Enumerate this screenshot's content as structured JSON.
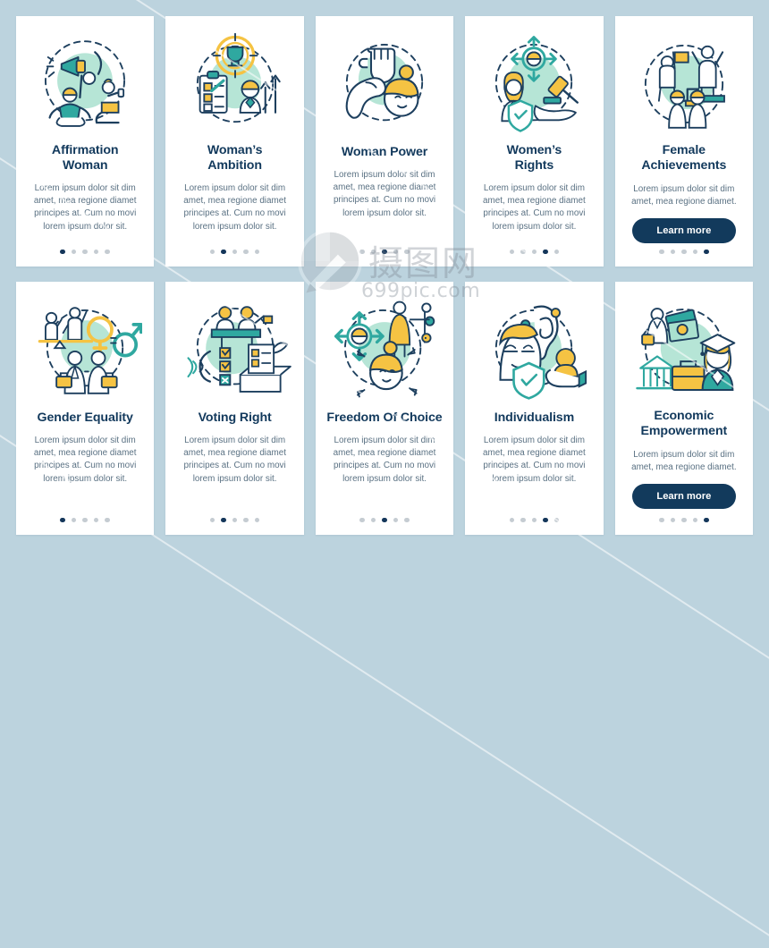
{
  "page": {
    "background_color": "#bcd3de",
    "card_background": "#ffffff",
    "title_color": "#12395c",
    "body_color": "#5a7183",
    "accent_teal": "#2fa8a0",
    "accent_mint": "#a8e0cd",
    "accent_yellow": "#f5c343",
    "button_color": "#123a5c",
    "dot_active_color": "#14365a",
    "dot_inactive_color": "#c5ccd2"
  },
  "watermark": {
    "chinese": "摄图网",
    "url": "699pic.com"
  },
  "common": {
    "lorem_long": "Lorem ipsum dolor sit dim amet, mea regione diamet principes at. Cum no movi lorem ipsum dolor sit.",
    "lorem_short": "Lorem ipsum dolor sit dim amet, mea regione diamet.",
    "learn_more_label": "Learn more"
  },
  "rows": [
    {
      "id": "row-1",
      "cards": [
        {
          "id": "affirmation-woman",
          "title": "Affirmation\nWoman",
          "title_line1": "Affirmation",
          "title_line2": "Woman",
          "description": "Lorem ipsum dolor sit dim amet, mea regione diamet principes at. Cum no movi lorem ipsum dolor sit.",
          "has_button": false,
          "button_label": "",
          "dots_total": 5,
          "dot_active_index": 0,
          "illustration": "megaphone-woman-dumbbell-icon"
        },
        {
          "id": "womans-ambition",
          "title": "Woman’s\nAmbition",
          "title_line1": "Woman’s",
          "title_line2": "Ambition",
          "description": "Lorem ipsum dolor sit dim amet, mea regione diamet principes at. Cum no movi lorem ipsum dolor sit.",
          "has_button": false,
          "button_label": "",
          "dots_total": 5,
          "dot_active_index": 1,
          "illustration": "trophy-target-checklist-icon"
        },
        {
          "id": "woman-power",
          "title": "Woman Power",
          "title_line1": "Woman Power",
          "title_line2": "",
          "description": "Lorem ipsum dolor sit dim amet, mea regione diamet principes at. Cum no movi lorem ipsum dolor sit.",
          "has_button": false,
          "button_label": "",
          "dots_total": 5,
          "dot_active_index": 2,
          "illustration": "fist-muscle-woman-icon"
        },
        {
          "id": "womens-rights",
          "title": "Women’s\nRights",
          "title_line1": "Women’s",
          "title_line2": "Rights",
          "description": "Lorem ipsum dolor sit dim amet, mea regione diamet principes at. Cum no movi lorem ipsum dolor sit.",
          "has_button": false,
          "button_label": "",
          "dots_total": 5,
          "dot_active_index": 3,
          "illustration": "gavel-shield-arrows-icon"
        },
        {
          "id": "female-achievements",
          "title": "Female\nAchievements",
          "title_line1": "Female",
          "title_line2": "Achievements",
          "description": "Lorem ipsum dolor sit dim amet, mea regione diamet.",
          "has_button": true,
          "button_label": "Learn more",
          "dots_total": 5,
          "dot_active_index": 4,
          "illustration": "podium-flag-stairs-icon"
        }
      ]
    },
    {
      "id": "row-2",
      "cards": [
        {
          "id": "gender-equality",
          "title": "Gender Equality",
          "title_line1": "Gender Equality",
          "title_line2": "",
          "description": "Lorem ipsum dolor sit dim amet, mea regione diamet principes at. Cum no movi lorem ipsum dolor sit.",
          "has_button": false,
          "button_label": "",
          "dots_total": 5,
          "dot_active_index": 0,
          "illustration": "scales-gender-symbols-icon"
        },
        {
          "id": "voting-right",
          "title": "Voting Right",
          "title_line1": "Voting Right",
          "title_line2": "",
          "description": "Lorem ipsum dolor sit dim amet, mea regione diamet principes at. Cum no movi lorem ipsum dolor sit.",
          "has_button": false,
          "button_label": "",
          "dots_total": 5,
          "dot_active_index": 1,
          "illustration": "ballot-box-checklist-icon"
        },
        {
          "id": "freedom-of-choice",
          "title": "Freedom Of Choice",
          "title_line1": "Freedom Of Choice",
          "title_line2": "",
          "description": "Lorem ipsum dolor sit dim amet, mea regione diamet principes at. Cum no movi lorem ipsum dolor sit.",
          "has_button": false,
          "button_label": "",
          "dots_total": 5,
          "dot_active_index": 2,
          "illustration": "arrows-choice-woman-icon"
        },
        {
          "id": "individualism",
          "title": "Individualism",
          "title_line1": "Individualism",
          "title_line2": "",
          "description": "Lorem ipsum dolor sit dim amet, mea regione diamet principes at. Cum no movi lorem ipsum dolor sit.",
          "has_button": false,
          "button_label": "",
          "dots_total": 5,
          "dot_active_index": 3,
          "illustration": "ear-shield-hand-icon"
        },
        {
          "id": "economic-empowerment",
          "title": "Economic\nEmpowerment",
          "title_line1": "Economic",
          "title_line2": "Empowerment",
          "description": "Lorem ipsum dolor sit dim amet, mea regione diamet.",
          "has_button": true,
          "button_label": "Learn more",
          "dots_total": 5,
          "dot_active_index": 4,
          "illustration": "bank-briefcase-graduate-icon"
        }
      ]
    }
  ]
}
